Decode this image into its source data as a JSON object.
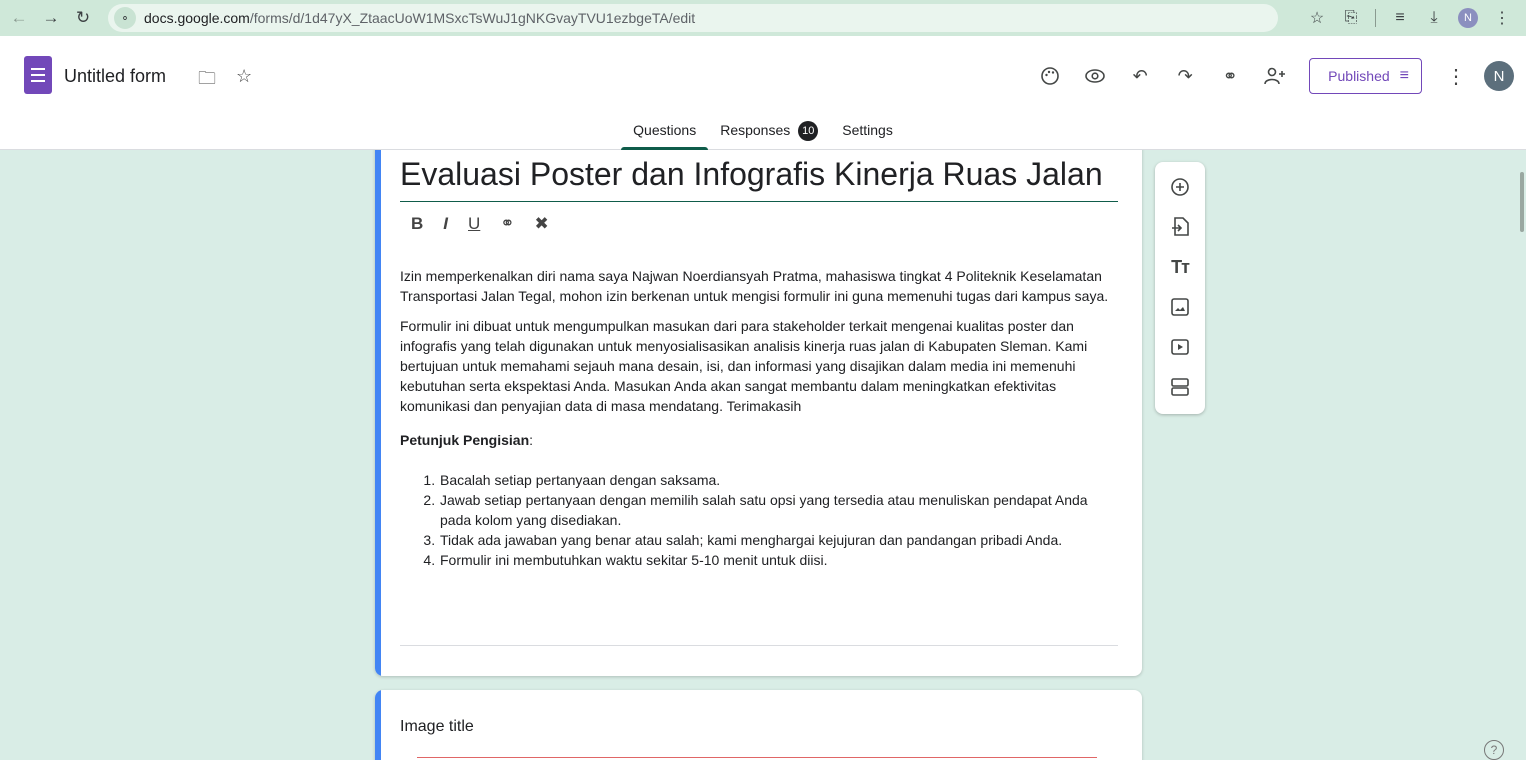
{
  "browser": {
    "url_host": "docs.google.com",
    "url_path": "/forms/d/1d47yX_ZtaacUoW1MSxcTsWuJ1gNKGvayTVU1ezbgeTA/edit",
    "profile_initial": "N",
    "icons": [
      "back-icon",
      "forward-icon",
      "reload-icon",
      "site-settings-icon",
      "bookmark-star-icon",
      "extensions-icon",
      "media-control-icon",
      "download-icon",
      "more-vert-icon"
    ]
  },
  "app": {
    "title": "Untitled form",
    "published_label": "Published",
    "avatar_initial": "N",
    "toolbar_icons": [
      "palette-icon",
      "preview-eye-icon",
      "undo-icon",
      "redo-icon",
      "link-icon",
      "add-collaborator-icon"
    ]
  },
  "tabs": [
    {
      "label": "Questions",
      "active": true
    },
    {
      "label": "Responses",
      "badge": "10"
    },
    {
      "label": "Settings"
    }
  ],
  "form": {
    "title": "Evaluasi Poster dan Infografis Kinerja Ruas Jalan",
    "formatting": [
      "B",
      "I",
      "U",
      "link",
      "clear-format"
    ],
    "desc_p1": "Izin memperkenalkan diri nama saya Najwan Noerdiansyah Pratma, mahasiswa tingkat 4 Politeknik Keselamatan Transportasi Jalan Tegal, mohon izin berkenan untuk mengisi formulir ini guna memenuhi tugas dari kampus saya.",
    "desc_p2": "Formulir ini dibuat untuk mengumpulkan masukan dari para stakeholder terkait mengenai kualitas poster dan infografis yang telah digunakan untuk menyosialisasikan analisis kinerja ruas jalan di Kabupaten Sleman. Kami bertujuan untuk memahami sejauh mana desain, isi, dan informasi yang disajikan dalam media ini memenuhi kebutuhan serta ekspektasi Anda. Masukan Anda akan sangat membantu dalam meningkatkan efektivitas komunikasi dan penyajian data di masa mendatang. Terimakasih",
    "guide_heading": "Petunjuk Pengisian",
    "guide_colon": ":",
    "instructions": [
      "Bacalah setiap pertanyaan dengan saksama.",
      "Jawab setiap pertanyaan dengan memilih salah satu opsi yang tersedia atau menuliskan pendapat Anda pada kolom yang disediakan.",
      "Tidak ada jawaban yang benar atau salah; kami menghargai kejujuran dan pandangan pribadi Anda.",
      "Formulir ini membutuhkan waktu sekitar 5-10 menit untuk diisi."
    ],
    "image_card_title": "Image title"
  },
  "side_toolbar": [
    "add-question-icon",
    "import-questions-icon",
    "add-title-icon",
    "add-image-icon",
    "add-video-icon",
    "add-section-icon"
  ],
  "colors": {
    "forms_purple": "#7248b9",
    "accent_blue": "#4285f4",
    "tab_underline": "#0f5c4a",
    "background": "#d9ede6"
  }
}
